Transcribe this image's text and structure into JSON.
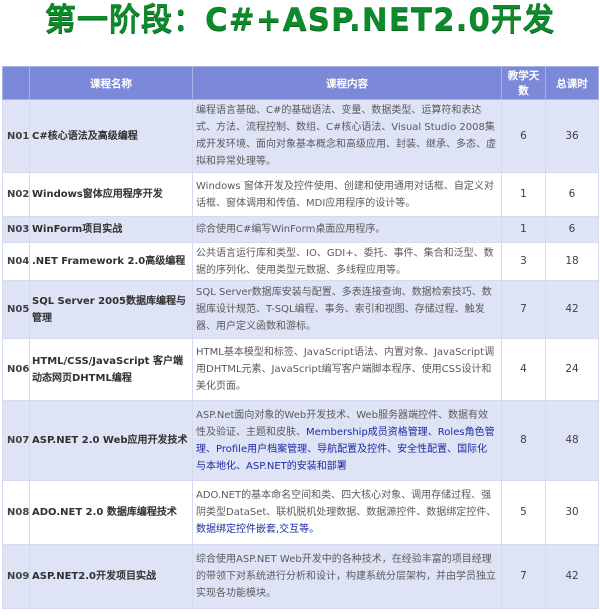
{
  "title": "第一阶段：C#+ASP.NET2.0开发",
  "table": {
    "headers": [
      "",
      "课程名称",
      "课程内容",
      "教学天数",
      "总课时"
    ],
    "rows": [
      {
        "code": "N01",
        "name": "C#核心语法及高级编程",
        "content": "编程语言基础、C#的基础语法、变量、数据类型、运算符和表达式、方法、流程控制、数组、C#核心语法、Visual Studio 2008集成开发环境、面向对象基本概念和高级应用、封装、继承、多态、虚拟和异常处理等。",
        "days": "6",
        "hours": "36"
      },
      {
        "code": "N02",
        "name": "Windows窗体应用程序开发",
        "content": "Windows 窗体开发及控件使用、创建和使用通用对话框、自定义对话框、窗体调用和传值、MDI应用程序的设计等。",
        "days": "1",
        "hours": "6"
      },
      {
        "code": "N03",
        "name": "WinForm项目实战",
        "content": "综合使用C#编写WinForm桌面应用程序。",
        "days": "1",
        "hours": "6"
      },
      {
        "code": "N04",
        "name": ".NET Framework 2.0高级编程",
        "content": "公共语言运行库和类型、IO、GDI+、委托、事件、集合和泛型、数据的序列化、使用类型元数据、多线程应用等。",
        "days": "3",
        "hours": "18"
      },
      {
        "code": "N05",
        "name": "SQL Server 2005数据库编程与管理",
        "content": "SQL Server数据库安装与配置、多表连接查询、数据检索技巧、数据库设计规范、T-SQL编程、事务、索引和视图、存储过程、触发器、用户定义函数和游标。",
        "days": "7",
        "hours": "42"
      },
      {
        "code": "N06",
        "name": "HTML/CSS/JavaScript 客户端动态网页DHTML编程",
        "content": "HTML基本模型和标签、JavaScript语法、内置对象、JavaScript调用DHTML元素、JavaScript编写客户端脚本程序、使用CSS设计和美化页面。",
        "days": "4",
        "hours": "24"
      },
      {
        "code": "N07",
        "name": "ASP.NET 2.0 Web应用开发技术",
        "content_plain": "ASP.Net面向对象的Web开发技术、Web服务器端控件、数据有效性及验证、主题和皮肤、",
        "content_hl": "Membership成员资格管理、Roles角色管理、Profile用户档案管理、导航配置及控件、安全性配置、国际化与本地化、ASP.NET的安装和部署",
        "days": "8",
        "hours": "48"
      },
      {
        "code": "N08",
        "name": "ADO.NET 2.0 数据库编程技术",
        "content_plain": "ADO.NET的基本命名空间和类、四大核心对象、调用存储过程、强阴类型DataSet、联机脱机处理数据、数据源控件、数据绑定控件、",
        "content_hl": "数据绑定控件嵌套,交互等。",
        "days": "5",
        "hours": "30"
      },
      {
        "code": "N09",
        "name": "ASP.NET2.0开发项目实战",
        "content": "综合使用ASP.NET Web开发中的各种技术，在经验丰富的项目经理的带领下对系统进行分析和设计，构建系统分层架构，并由学员独立实现各功能模块。",
        "days": "7",
        "hours": "42"
      }
    ]
  }
}
